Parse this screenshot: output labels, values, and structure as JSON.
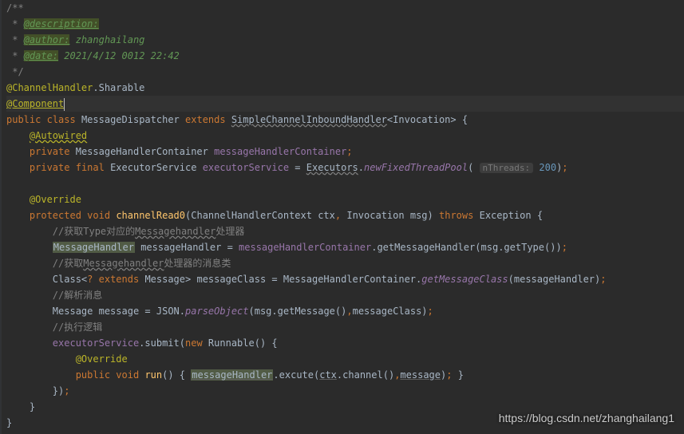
{
  "doc": {
    "open": "/**",
    "descTag": "@description:",
    "authorTag": "@author:",
    "authorVal": " zhanghailang",
    "dateTag": "@date:",
    "dateVal": " 2021/4/12 0012 22:42",
    "close": " */",
    "star": " * "
  },
  "anno": {
    "sharable": "@ChannelHandler",
    "sharableSub": ".Sharable",
    "component": "@Component",
    "autowired": "@Autowired",
    "override": "@Override"
  },
  "kw": {
    "public": "public",
    "class": "class",
    "extends": "extends",
    "private": "private",
    "final": "final",
    "protected": "protected",
    "void": "void",
    "throws": "throws",
    "new": "new"
  },
  "cls": {
    "name": "MessageDispatcher",
    "parent": "SimpleChannelInboundHandler",
    "generic": "Invocation",
    "mhc": "MessageHandlerContainer",
    "exec": "ExecutorService",
    "executors": "Executors",
    "mh": "MessageHandler",
    "ctxType": "ChannelHandlerContext",
    "invocation": "Invocation",
    "exception": "Exception",
    "classKw": "Class",
    "message": "Message",
    "json": "JSON",
    "runnable": "Runnable"
  },
  "field": {
    "mhc": "messageHandlerContainer",
    "exec": "executorService"
  },
  "method": {
    "newPool": "newFixedThreadPool",
    "cr0": "channelRead0",
    "getMH": "getMessageHandler",
    "getType": "getType",
    "getMC": "getMessageClass",
    "parse": "parseObject",
    "getMsg": "getMessage",
    "submit": "submit",
    "run": "run",
    "excute": "excute",
    "channel": "channel"
  },
  "var": {
    "ctx": "ctx",
    "msg": "msg",
    "mh": "messageHandler",
    "mc": "messageClass",
    "message": "message"
  },
  "hint": {
    "nThreads": "nThreads:"
  },
  "num": {
    "pool": "200"
  },
  "comments": {
    "c1": "//获取Type对应的",
    "c1b": "Messagehandler",
    "c1c": "处理器",
    "c2": "//获取",
    "c2b": "Messagehandler",
    "c2c": "处理器的消息类",
    "c3": "//解析消息",
    "c4": "//执行逻辑"
  },
  "sym": {
    "lt": "<",
    "gt": ">",
    "ob": "{",
    "cb": "}",
    "op": "(",
    "cp": ")",
    "sc": ";",
    "eq": " = ",
    "comma": ",",
    "dot": ".",
    "q": "?",
    "sp": " "
  },
  "watermark": "https://blog.csdn.net/zhanghailang1"
}
